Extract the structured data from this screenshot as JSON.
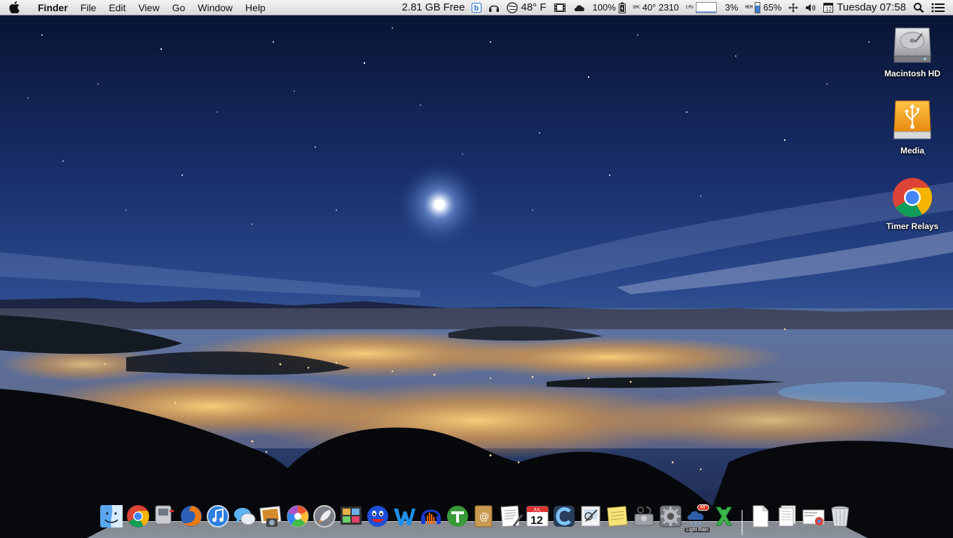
{
  "menubar": {
    "app_name": "Finder",
    "menus": [
      "File",
      "Edit",
      "View",
      "Go",
      "Window",
      "Help"
    ],
    "disk_free": "2.81 GB Free",
    "weather": "48° F",
    "battery": "100%",
    "temp_sensor_label": "SMC",
    "temp_fan": "40° 2310",
    "cpu_label": "CPU",
    "cpu_percent": "3%",
    "cpu_level": 0.03,
    "mem_label": "MEM",
    "mem_percent": "65%",
    "mem_level": 0.65,
    "clock": "Tuesday 07:58"
  },
  "desktop_icons": [
    {
      "label": "Macintosh HD",
      "icon": "hard-drive-icon"
    },
    {
      "label": "Media",
      "icon": "usb-drive-icon"
    },
    {
      "label": "Timer Relays",
      "icon": "chrome-icon"
    }
  ],
  "dock": {
    "calendar_day": "12",
    "calendar_month": "JUL",
    "weather_widget_label": "Light Rain",
    "weather_widget_badge": "48°",
    "apps": [
      "finder-icon",
      "chrome-icon",
      "mail-icon",
      "firefox-icon",
      "itunes-icon",
      "messages-icon",
      "iphoto-icon",
      "picasa-icon",
      "launchpad-icon",
      "photo-booth-icon",
      "smiley-chat-icon",
      "wordweb-icon",
      "audacity-icon",
      "utorrent-icon",
      "address-book-icon",
      "textedit-icon",
      "calendar-icon",
      "cinch-icon",
      "preview-icon",
      "stickies-icon",
      "disk-utility-icon",
      "system-preferences-icon",
      "weather-widget-icon",
      "xmind-icon"
    ],
    "stacks": [
      "document-icon",
      "downloads-stack-icon",
      "chrome-app-stack-icon",
      "trash-icon"
    ]
  },
  "colors": {
    "sky_top": "#0a1636",
    "sky_mid": "#1f3a78",
    "city_glow": "#f2a53c",
    "menubar": "#e4e4e4"
  }
}
